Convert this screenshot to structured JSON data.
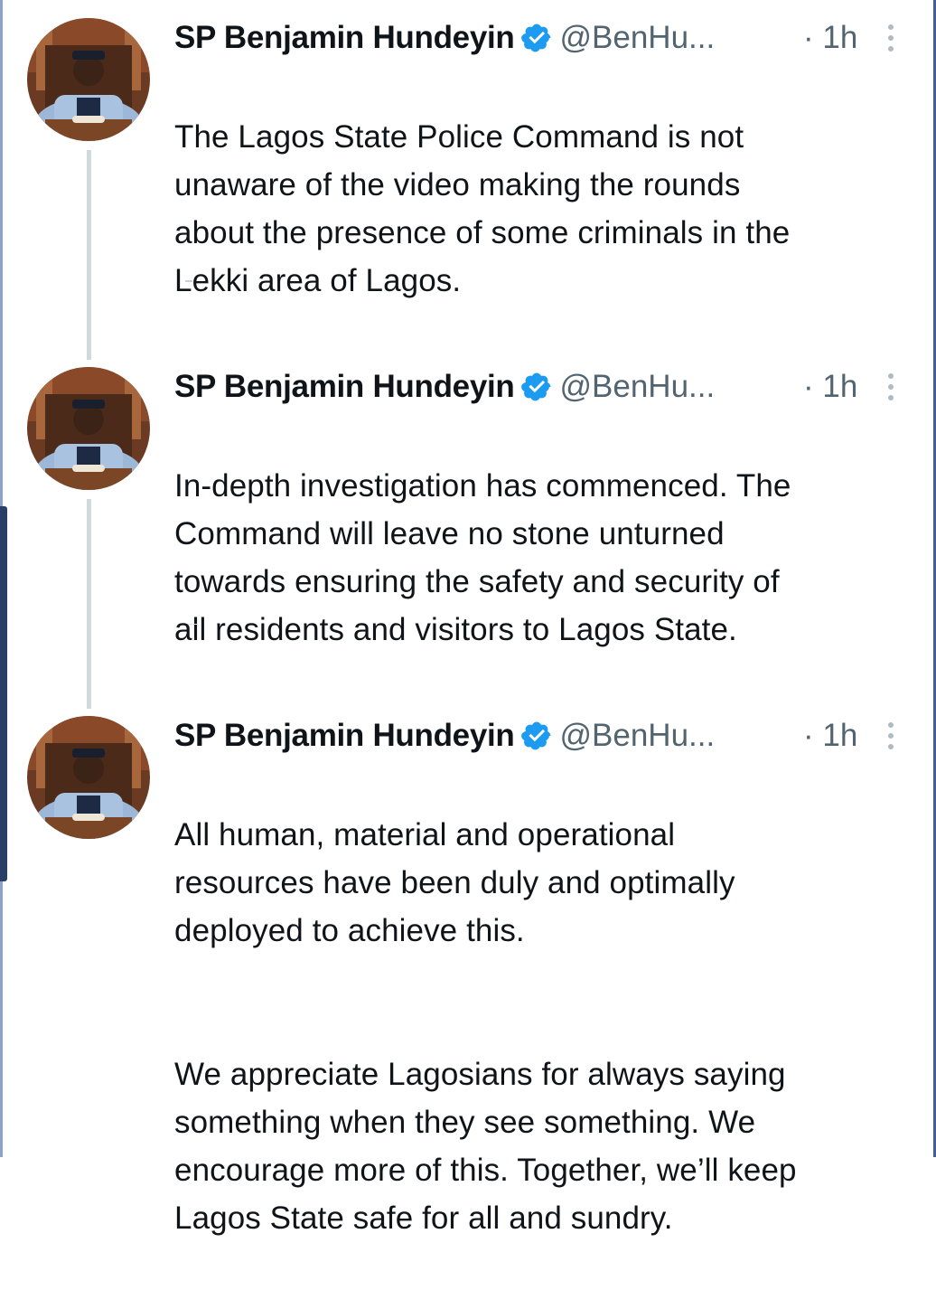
{
  "tweets": [
    {
      "name": "SP Benjamin Hundeyin",
      "handle": "@BenHu...",
      "time": "· 1h",
      "paragraphs": [
        "The Lagos State Police Command is not\nunaware of the video making the rounds\nabout the presence of some criminals in the\nLekki area of Lagos."
      ]
    },
    {
      "name": "SP Benjamin Hundeyin",
      "handle": "@BenHu...",
      "time": "· 1h",
      "paragraphs": [
        "In-depth investigation has commenced. The\nCommand will leave no stone unturned\ntowards ensuring the safety and security of\nall residents and visitors to Lagos State."
      ]
    },
    {
      "name": "SP Benjamin Hundeyin",
      "handle": "@BenHu...",
      "time": "· 1h",
      "paragraphs": [
        "All human, material and operational\nresources have been duly and optimally\ndeployed to achieve this.",
        "We appreciate Lagosians for always saying\nsomething when they see something. We\nencourage more of this. Together, we’ll keep\nLagos State safe for all and sundry."
      ]
    }
  ],
  "icons": {
    "verified": "verified-badge-icon",
    "more": "more-vertical-icon"
  },
  "colors": {
    "verified": "#1d9bf0",
    "text": "#0f1419",
    "secondary": "#536471",
    "thread_line": "#cfd9de"
  }
}
